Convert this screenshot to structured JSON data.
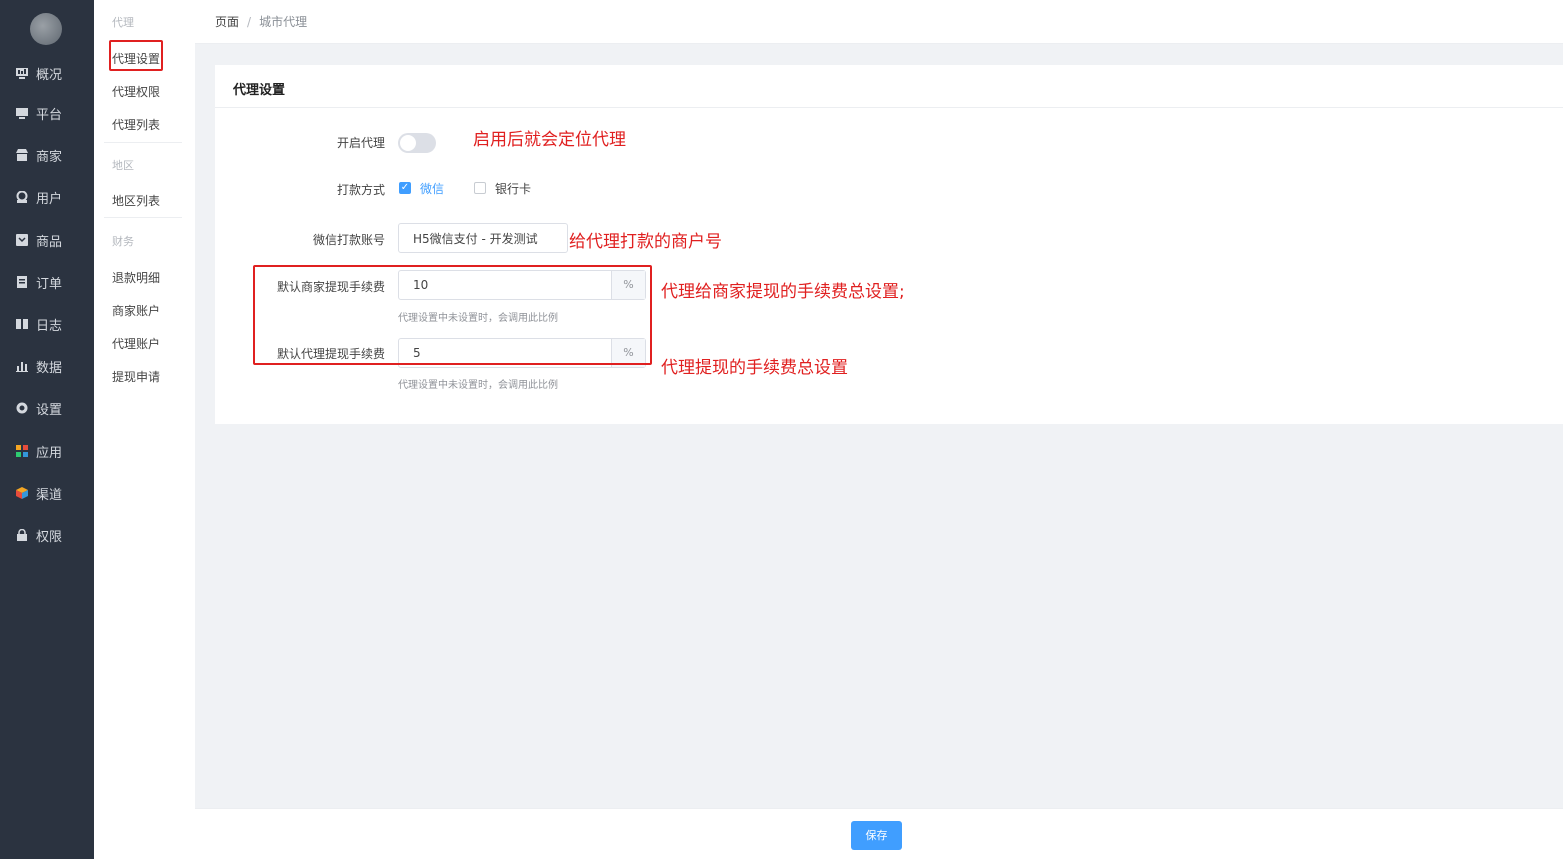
{
  "nav": {
    "items": [
      {
        "label": "概况",
        "icon": "chart-icon"
      },
      {
        "label": "平台",
        "icon": "monitor-icon"
      },
      {
        "label": "商家",
        "icon": "store-icon"
      },
      {
        "label": "用户",
        "icon": "user-icon"
      },
      {
        "label": "商品",
        "icon": "goods-icon"
      },
      {
        "label": "订单",
        "icon": "order-icon"
      },
      {
        "label": "日志",
        "icon": "log-icon"
      },
      {
        "label": "数据",
        "icon": "bar-icon"
      },
      {
        "label": "设置",
        "icon": "gear-icon"
      },
      {
        "label": "应用",
        "icon": "apps-icon"
      },
      {
        "label": "渠道",
        "icon": "cube-icon"
      },
      {
        "label": "权限",
        "icon": "lock-icon"
      }
    ]
  },
  "subnav": {
    "group_agent": "代理",
    "agent_settings": "代理设置",
    "agent_permissions": "代理权限",
    "agent_list": "代理列表",
    "group_region": "地区",
    "region_list": "地区列表",
    "group_finance": "财务",
    "refund_detail": "退款明细",
    "merchant_account": "商家账户",
    "agent_account": "代理账户",
    "withdraw_apply": "提现申请"
  },
  "breadcrumb": {
    "root": "页面",
    "separator": "/",
    "current": "城市代理"
  },
  "panel": {
    "title": "代理设置",
    "enable_label": "开启代理",
    "enable_on": false,
    "payout_label": "打款方式",
    "payout_wechat": "微信",
    "payout_wechat_checked": true,
    "payout_bank": "银行卡",
    "payout_bank_checked": false,
    "wechat_account_label": "微信打款账号",
    "wechat_account_value": "H5微信支付 - 开发测试",
    "merchant_fee_label": "默认商家提现手续费",
    "merchant_fee_value": "10",
    "agent_fee_label": "默认代理提现手续费",
    "agent_fee_value": "5",
    "percent": "%",
    "hint": "代理设置中未设置时，会调用此比例"
  },
  "annotations": {
    "enable": "启用后就会定位代理",
    "account": "给代理打款的商户号",
    "merchant_fee": "代理给商家提现的手续费总设置;",
    "agent_fee": "代理提现的手续费总设置"
  },
  "footer": {
    "save": "保存"
  },
  "colors": {
    "nav_bg": "#2b3340",
    "primary": "#409eff",
    "annotation": "#e02020"
  }
}
